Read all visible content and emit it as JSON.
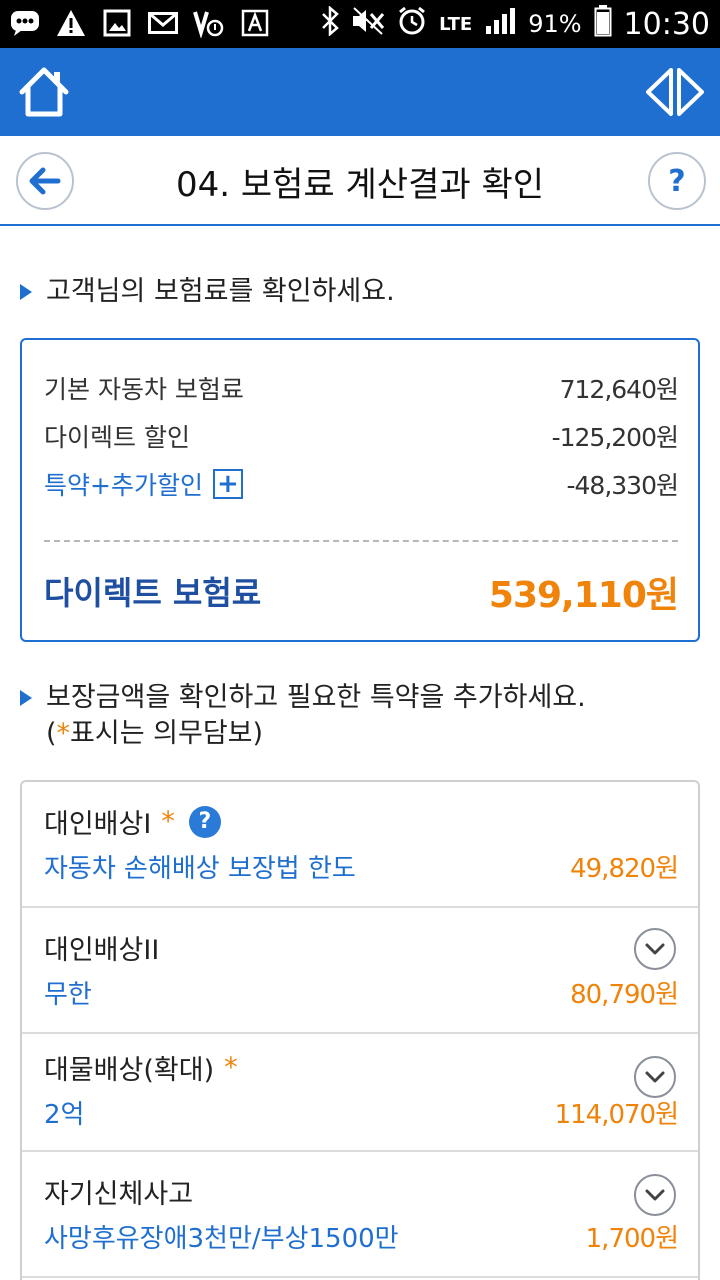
{
  "status_bar": {
    "battery": "91%",
    "time": "10:30",
    "network": "LTE",
    "icons": [
      "chat-icon",
      "warning-icon",
      "image-icon",
      "mail-icon",
      "voicemail-icon",
      "a-icon",
      "bluetooth-icon",
      "mute-icon",
      "alarm-icon",
      "signal-icon",
      "battery-icon"
    ]
  },
  "header": {
    "title": "04. 보험료 계산결과 확인",
    "help_label": "?"
  },
  "premium_section": {
    "heading": "고객님의 보험료를 확인하세요.",
    "rows": [
      {
        "label": "기본 자동차 보험료",
        "value": "712,640원"
      },
      {
        "label": "다이렉트 할인",
        "value": "-125,200원"
      },
      {
        "label": "특약+추가할인",
        "value": "-48,330원",
        "expand_label": "+"
      }
    ],
    "total_label": "다이렉트 보험료",
    "total_value": "539,110원"
  },
  "coverage_section": {
    "heading_line1": "보장금액을 확인하고 필요한 특약을 추가하세요.",
    "heading_open": "(",
    "heading_star": "*",
    "heading_rest": "표시는 의무담보)",
    "items": [
      {
        "name": "대인배상I",
        "star": "*",
        "help": "?",
        "detail": "자동차 손해배상 보장법 한도",
        "price": "49,820원"
      },
      {
        "name": "대인배상II",
        "star": "",
        "detail": "무한",
        "price": "80,790원"
      },
      {
        "name": "대물배상(확대)",
        "star": "*",
        "detail": "2억",
        "price": "114,070원"
      },
      {
        "name": "자기신체사고",
        "star": "",
        "detail": "사망후유장애3천만/부상1500만",
        "price": "1,700원"
      }
    ]
  },
  "colors": {
    "brand_blue": "#1f6fd1",
    "accent_orange": "#f0830a"
  }
}
